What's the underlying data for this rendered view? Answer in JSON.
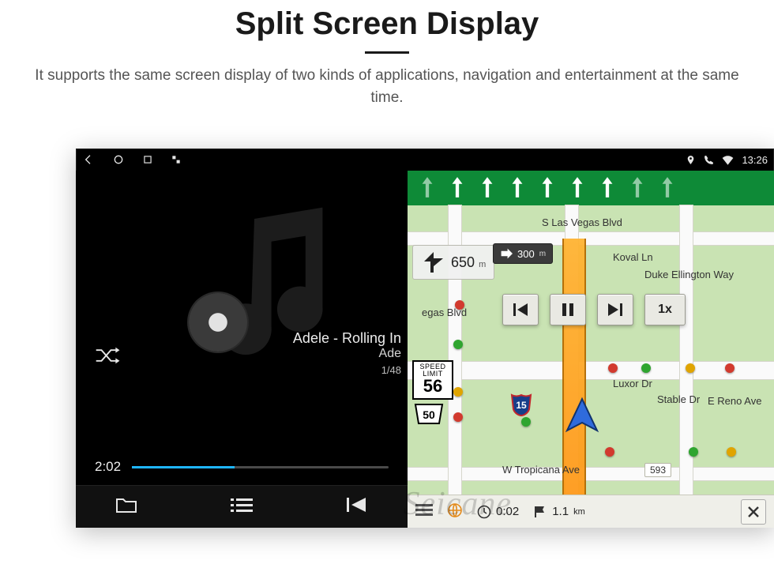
{
  "header": {
    "title": "Split Screen Display",
    "description": "It supports the same screen display of two kinds of applications, navigation and entertainment at the same time."
  },
  "statusbar": {
    "time": "13:26"
  },
  "music": {
    "track_title": "Adele - Rolling In",
    "artist_line": "Ade",
    "track_index": "1/48",
    "elapsed": "2:02"
  },
  "nav": {
    "turn_distance_value": "650",
    "turn_distance_unit": "m",
    "next_turn_value": "300",
    "next_turn_unit": "m",
    "speed_limit_top": "SPEED",
    "speed_limit_mid": "LIMIT",
    "speed_limit_value": "56",
    "highway_label": "50",
    "interstate_label": "15",
    "speed_btn": "1x",
    "streets": {
      "s_lasvegas": "S Las Vegas Blvd",
      "koval": "Koval Ln",
      "duke": "Duke Ellington Way",
      "luxor": "Luxor Dr",
      "stable": "Stable Dr",
      "reno": "E Reno Ave",
      "tropicana": "W Tropicana Ave",
      "tropicana_no": "593",
      "vegas_blvd_short": "egas Blvd"
    },
    "bottom": {
      "eta_time": "0:02",
      "remain_value": "1.1",
      "remain_unit": "km"
    }
  },
  "watermark": "Seicane"
}
